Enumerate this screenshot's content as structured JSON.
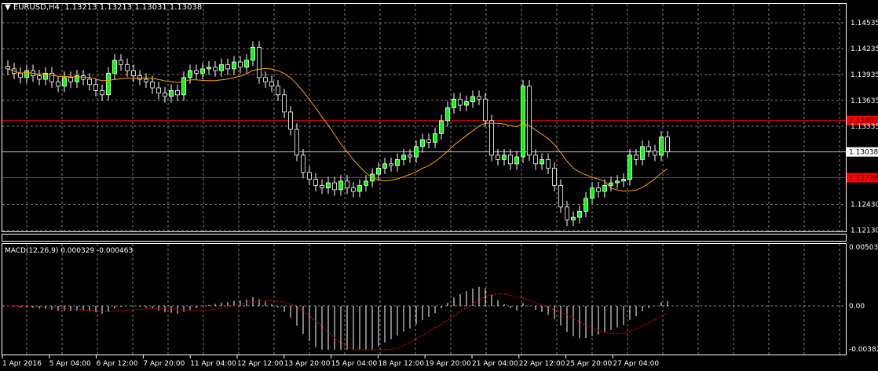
{
  "header": {
    "symbol": "EURUSD,H4",
    "ohlc": "1.13213 1.13213 1.13031 1.13038",
    "menu_icon": "triangle-down-icon"
  },
  "price_axis": {
    "ticks": [
      "1.14535",
      "1.14235",
      "1.13935",
      "1.13635",
      "1.13335",
      "1.12430",
      "1.12130"
    ]
  },
  "levels": {
    "resistance": {
      "value": "1.13401",
      "color": "#ff0000"
    },
    "support": {
      "value": "1.12739",
      "color": "#ff0000"
    },
    "current": {
      "value": "1.13038",
      "color": "#c0c0c0"
    }
  },
  "macd": {
    "label": "MACD(12,26,9) 0.000329 -0.000463",
    "ticks": [
      "0.005033",
      "0.00",
      "-0.003823"
    ],
    "hist_color": "#ffffff",
    "signal_color": "#ff0000"
  },
  "time_axis": {
    "labels": [
      "1 Apr 2016",
      "5 Apr 04:00",
      "6 Apr 12:00",
      "7 Apr 20:00",
      "11 Apr 04:00",
      "12 Apr 12:00",
      "13 Apr 20:00",
      "15 Apr 04:00",
      "18 Apr 12:00",
      "19 Apr 20:00",
      "21 Apr 04:00",
      "22 Apr 12:00",
      "25 Apr 20:00",
      "27 Apr 04:00"
    ]
  },
  "colors": {
    "bull": "#00ff00",
    "bear": "#ffffff",
    "ma": "#ffa500",
    "grid": "#7f7f7f"
  },
  "chart_data": {
    "type": "candlestick",
    "symbol": "EURUSD",
    "timeframe": "H4",
    "ylim": [
      1.1205,
      1.1468
    ],
    "close": [
      1.14,
      1.1395,
      1.139,
      1.1398,
      1.1392,
      1.1388,
      1.1395,
      1.1385,
      1.138,
      1.139,
      1.1385,
      1.1392,
      1.1388,
      1.1382,
      1.1375,
      1.137,
      1.1395,
      1.141,
      1.1405,
      1.1398,
      1.1392,
      1.1388,
      1.1385,
      1.1378,
      1.1372,
      1.1368,
      1.1375,
      1.137,
      1.139,
      1.1398,
      1.1395,
      1.14,
      1.1402,
      1.1398,
      1.1405,
      1.14,
      1.1408,
      1.1402,
      1.141,
      1.1425,
      1.139,
      1.1385,
      1.138,
      1.137,
      1.135,
      1.133,
      1.13,
      1.128,
      1.1272,
      1.1265,
      1.1262,
      1.1268,
      1.126,
      1.127,
      1.1262,
      1.1258,
      1.1265,
      1.127,
      1.1278,
      1.1285,
      1.129,
      1.1288,
      1.1295,
      1.13,
      1.1298,
      1.131,
      1.1318,
      1.1315,
      1.1325,
      1.134,
      1.1355,
      1.1365,
      1.1358,
      1.1362,
      1.1368,
      1.1365,
      1.134,
      1.13,
      1.1295,
      1.13,
      1.129,
      1.1298,
      1.138,
      1.13,
      1.129,
      1.1295,
      1.1285,
      1.1265,
      1.124,
      1.1225,
      1.1228,
      1.1235,
      1.125,
      1.1262,
      1.1258,
      1.1265,
      1.1268,
      1.127,
      1.1272,
      1.13,
      1.1295,
      1.131,
      1.1305,
      1.13,
      1.1321,
      1.1304
    ],
    "macd_ylim": [
      -0.003823,
      0.005033
    ]
  }
}
